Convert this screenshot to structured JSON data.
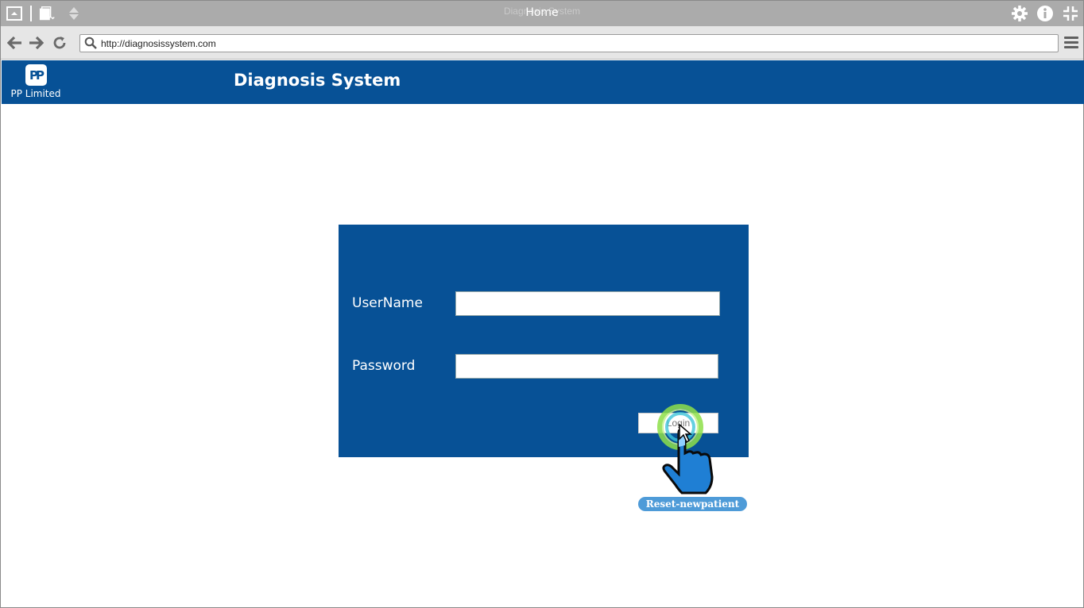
{
  "browser": {
    "window_title": "Home",
    "window_title_ghost": "Diagnosis System",
    "url": "http://diagnosissystem.com",
    "icons": [
      "window-icon",
      "pages-icon",
      "sort-icon",
      "gear-icon",
      "info-icon",
      "collapse-icon"
    ],
    "nav": {
      "back": "←",
      "forward": "→",
      "reload": "↻"
    }
  },
  "header": {
    "logo_mark": "PP",
    "logo_text": "PP Limited",
    "app_title": "Diagnosis System",
    "color": "#075196"
  },
  "login": {
    "username_label": "UserName",
    "username_value": "",
    "password_label": "Password",
    "password_value": "",
    "login_button": "Login"
  },
  "annotation": {
    "label": "Reset-newpatient",
    "color": "#4e9bd8"
  }
}
